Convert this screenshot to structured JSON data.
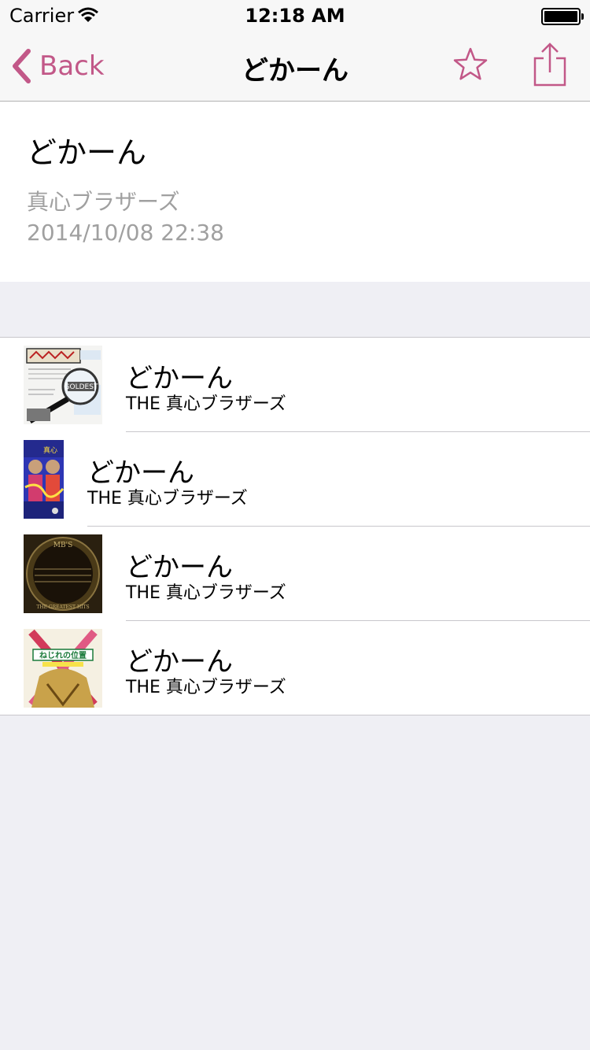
{
  "status_bar": {
    "carrier": "Carrier",
    "time": "12:18 AM"
  },
  "nav": {
    "back_label": "Back",
    "title": "どかーん"
  },
  "info": {
    "title": "どかーん",
    "artist": "真心ブラザーズ",
    "date": "2014/10/08 22:38"
  },
  "tracks": [
    {
      "title": "どかーん",
      "artist": "THE 真心ブラザーズ",
      "art_text": "GOLDEST"
    },
    {
      "title": "どかーん",
      "artist": "THE 真心ブラザーズ",
      "art_text": "真心"
    },
    {
      "title": "どかーん",
      "artist": "THE 真心ブラザーズ",
      "art_text": "THE GREATEST HITS"
    },
    {
      "title": "どかーん",
      "artist": "THE 真心ブラザーズ",
      "art_text": "ねじれの位置"
    }
  ],
  "colors": {
    "accent": "#c25888",
    "secondary_text": "#a0a0a0",
    "background": "#efeff4",
    "separator": "#c8c7cc"
  },
  "icons": {
    "back": "chevron-left-icon",
    "favorite": "star-outline-icon",
    "share": "share-icon",
    "wifi": "wifi-icon",
    "battery": "battery-icon"
  }
}
